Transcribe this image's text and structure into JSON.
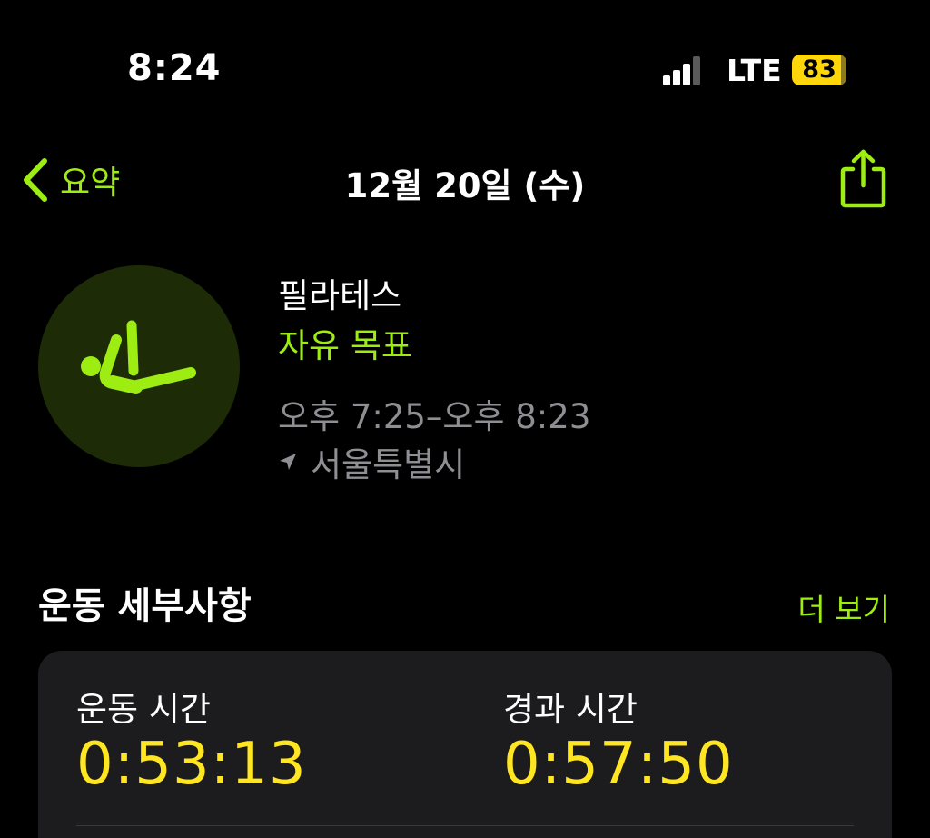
{
  "status_bar": {
    "time": "8:24",
    "network": "LTE",
    "battery": "83"
  },
  "nav": {
    "back_label": "요약",
    "title": "12월 20일 (수)"
  },
  "workout": {
    "name": "필라테스",
    "goal": "자유 목표",
    "time_range": "오후 7:25–오후 8:23",
    "location": "서울특별시"
  },
  "details": {
    "title": "운동 세부사항",
    "more_label": "더 보기",
    "workout_time_label": "운동 시간",
    "workout_time_value": "0:53:13",
    "elapsed_time_label": "경과 시간",
    "elapsed_time_value": "0:57:50"
  },
  "colors": {
    "accent": "#9ded13",
    "value": "#ffe620",
    "card": "#1c1c1e",
    "secondary": "#8e8e93"
  }
}
